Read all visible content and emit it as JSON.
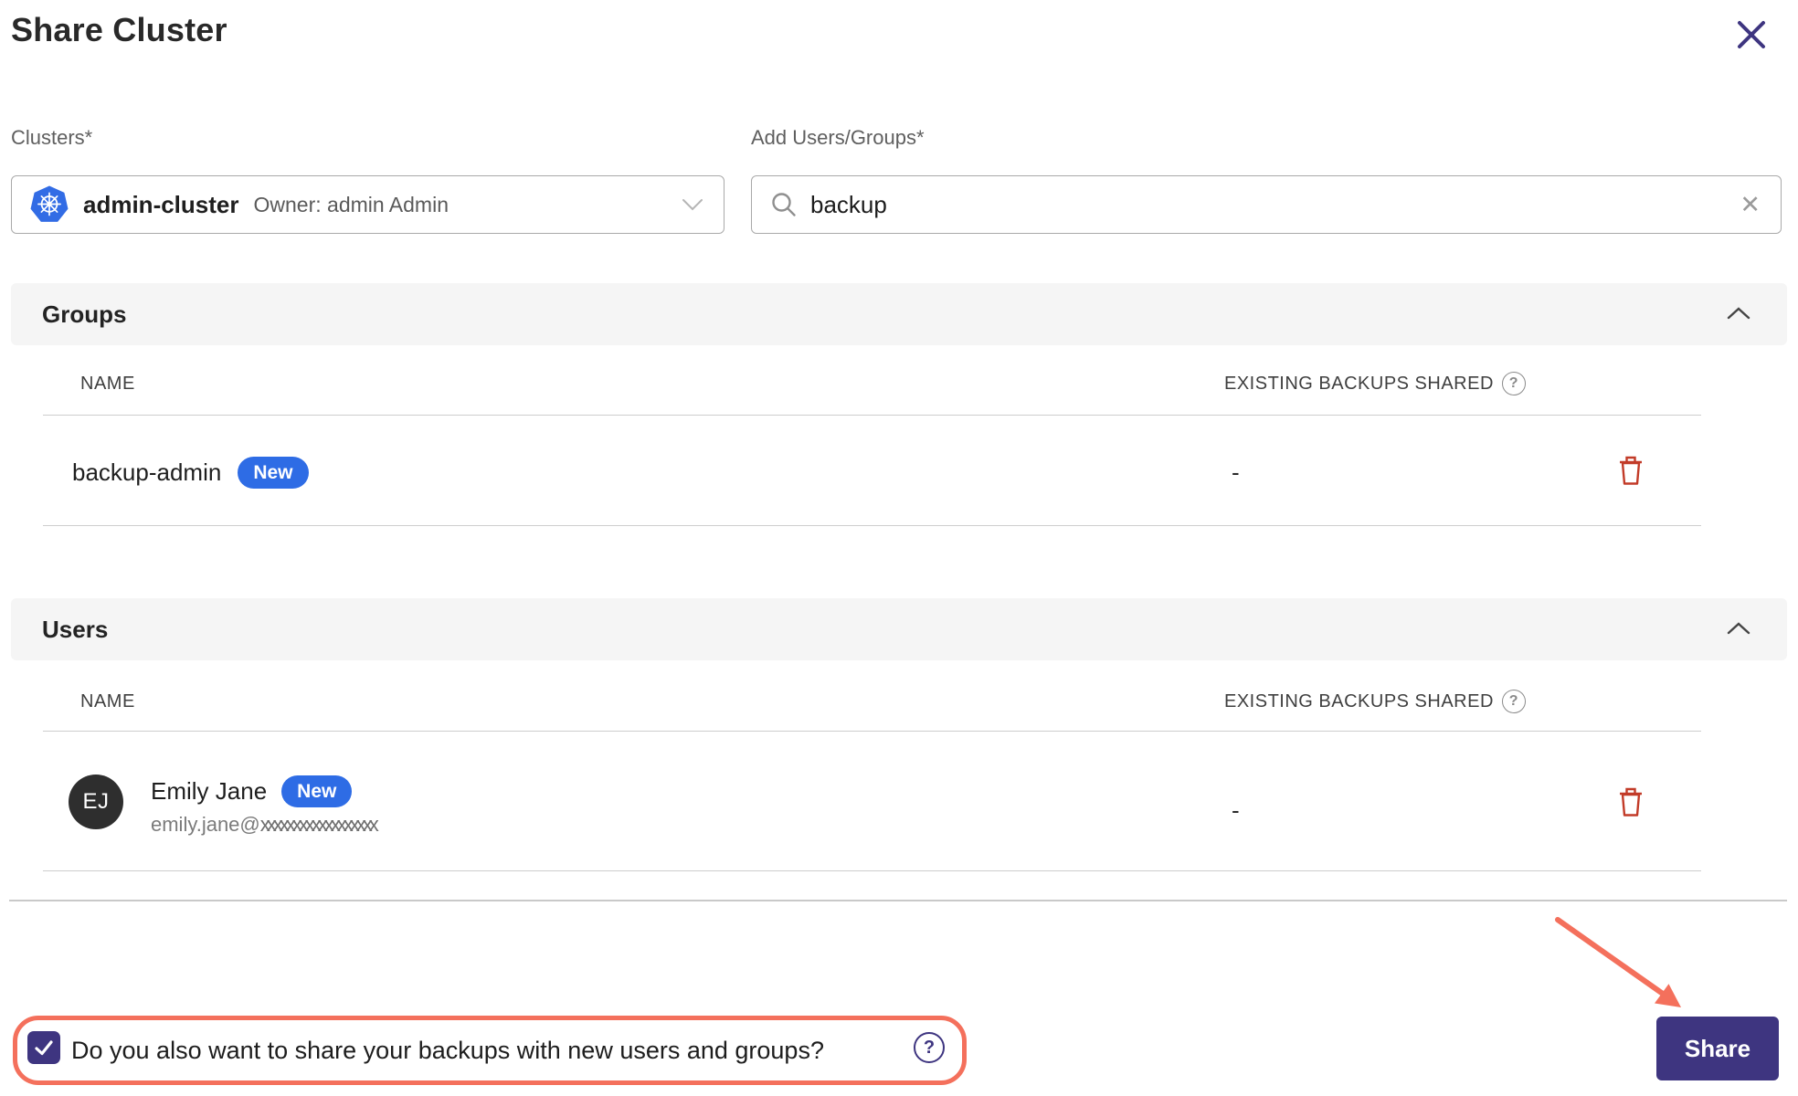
{
  "dialog": {
    "title": "Share Cluster"
  },
  "form": {
    "clusters_label": "Clusters*",
    "cluster_name": "admin-cluster",
    "cluster_owner": "Owner: admin Admin",
    "add_label": "Add Users/Groups*",
    "search_value": "backup"
  },
  "table": {
    "name_header": "NAME",
    "backups_header": "EXISTING BACKUPS SHARED"
  },
  "groups": {
    "title": "Groups",
    "rows": [
      {
        "name": "backup-admin",
        "badge": "New",
        "backups_shared": "-"
      }
    ]
  },
  "users": {
    "title": "Users",
    "rows": [
      {
        "initials": "EJ",
        "name": "Emily Jane",
        "badge": "New",
        "email_user": "emily.jane@",
        "email_redacted": "xxxxxxxxxxxxxxxxxx",
        "backups_shared": "-"
      }
    ]
  },
  "footer": {
    "question": "Do you also want to share your backups with new users and groups?",
    "checkbox_checked": true,
    "share_label": "Share"
  },
  "icons": {
    "help": "?",
    "clear": "✕"
  },
  "colors": {
    "accent": "#3E3580",
    "badge_blue": "#2E6CE5",
    "danger_red": "#C23B28",
    "annotation": "#F4705C",
    "kubernetes_blue": "#326CE5",
    "section_bg": "#F5F5F5"
  }
}
